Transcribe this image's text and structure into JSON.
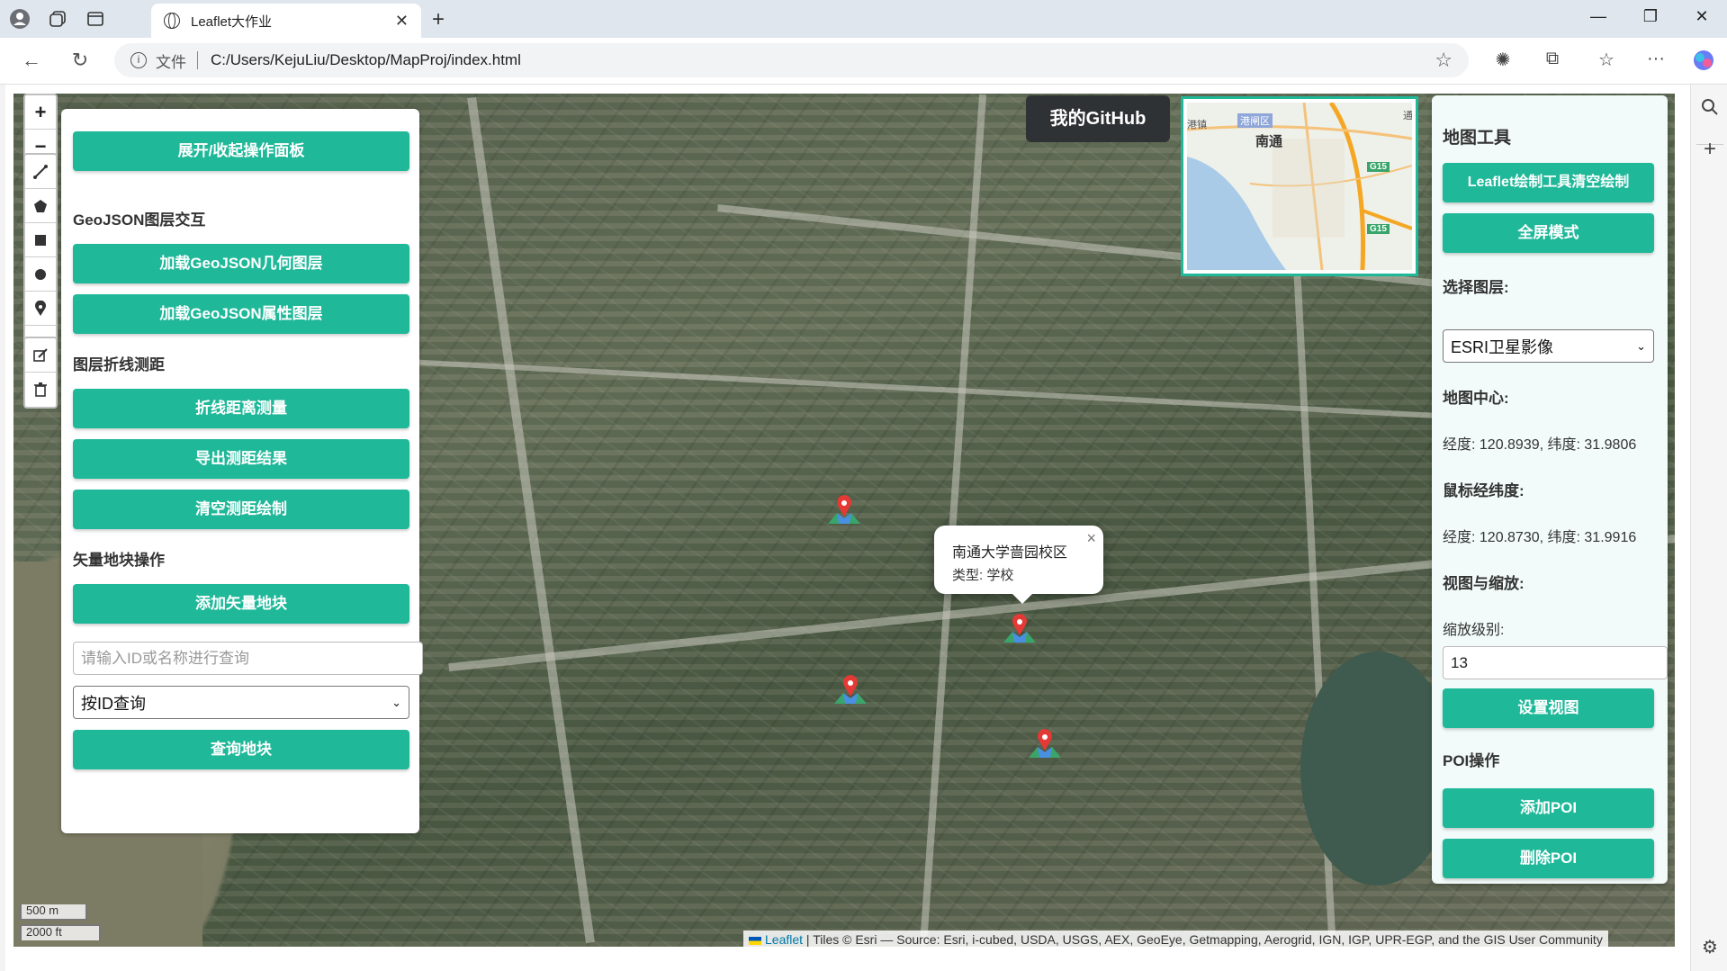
{
  "browser": {
    "tab_title": "Leaflet大作业",
    "file_label": "文件",
    "url": "C:/Users/KejuLiu/Desktop/MapProj/index.html"
  },
  "left_panel": {
    "toggle_button": "展开/收起操作面板",
    "sections": {
      "geojson_heading": "GeoJSON图层交互",
      "geojson_geometry_button": "加载GeoJSON几何图层",
      "geojson_attribute_button": "加载GeoJSON属性图层",
      "measure_heading": "图层折线测距",
      "measure_button": "折线距离测量",
      "export_button": "导出测距结果",
      "clear_measure_button": "清空测距绘制",
      "vector_heading": "矢量地块操作",
      "add_vector_button": "添加矢量地块",
      "query_placeholder": "请输入ID或名称进行查询",
      "query_mode": "按ID查询",
      "query_button": "查询地块"
    }
  },
  "right_panel": {
    "title": "地图工具",
    "clear_draw_button": "Leaflet绘制工具清空绘制",
    "fullscreen_button": "全屏模式",
    "layer_label": "选择图层:",
    "layer_value": "ESRI卫星影像",
    "center_label": "地图中心:",
    "center_value": "经度: 120.8939, 纬度: 31.9806",
    "mouse_label": "鼠标经纬度:",
    "mouse_value": "经度: 120.8730, 纬度: 31.9916",
    "view_label": "视图与缩放:",
    "zoom_label": "缩放级别:",
    "zoom_value": "13",
    "set_view_button": "设置视图",
    "poi_label": "POI操作",
    "add_poi_button": "添加POI",
    "delete_poi_button": "删除POI"
  },
  "map": {
    "github_label": "我的GitHub",
    "popup_title": "南通大学啬园校区",
    "popup_type": "类型: 学校",
    "minimap_labels": {
      "district": "港闸区",
      "city": "南通",
      "highway1": "G15",
      "highway2": "G15",
      "edge_left": "港镇",
      "edge_right": "通"
    },
    "scale_metric": "500 m",
    "scale_imperial": "2000 ft",
    "attribution_link": "Leaflet",
    "attribution_text": " | Tiles © Esri — Source: Esri, i-cubed, USDA, USGS, AEX, GeoEye, Getmapping, Aerogrid, IGN, IGP, UPR-EGP, and the GIS User Community",
    "zoom_in": "+",
    "zoom_out": "−",
    "accent_color": "#1fb899"
  }
}
